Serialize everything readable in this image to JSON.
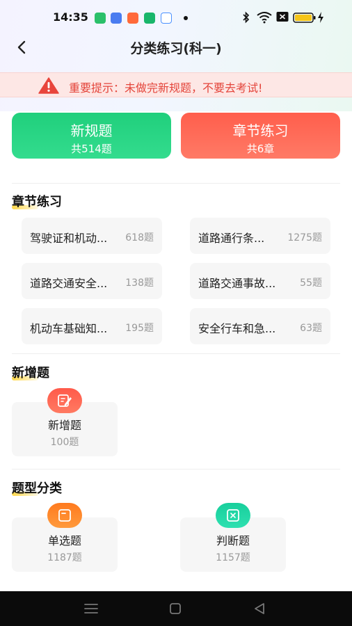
{
  "status_bar": {
    "time": "14:35"
  },
  "header": {
    "title": "分类练习(科一)"
  },
  "notice": {
    "text": "重要提示：未做完新规题，不要去考试!"
  },
  "main_cards": [
    {
      "title": "新规题",
      "subtitle": "共514题"
    },
    {
      "title": "章节练习",
      "subtitle": "共6章"
    }
  ],
  "chapters": {
    "title": "章节练习",
    "items": [
      {
        "name": "驾驶证和机动...",
        "count": "618题"
      },
      {
        "name": "道路通行条...",
        "count": "1275题"
      },
      {
        "name": "道路交通安全...",
        "count": "138题"
      },
      {
        "name": "道路交通事故...",
        "count": "55题"
      },
      {
        "name": "机动车基础知...",
        "count": "195题"
      },
      {
        "name": "安全行车和急...",
        "count": "63题"
      }
    ]
  },
  "new_questions": {
    "title": "新增题",
    "item": {
      "name": "新增题",
      "count": "100题",
      "icon": "edit-icon"
    }
  },
  "question_types": {
    "title": "题型分类",
    "items": [
      {
        "name": "单选题",
        "count": "1187题",
        "icon": "single-choice-icon"
      },
      {
        "name": "判断题",
        "count": "1157题",
        "icon": "true-false-icon"
      }
    ]
  },
  "colors": {
    "green": "#20cf7c",
    "red": "#ff5e4c",
    "notice_text": "#e4443a",
    "notice_bg": "#fde7e5",
    "highlight": "#ffd84a"
  }
}
